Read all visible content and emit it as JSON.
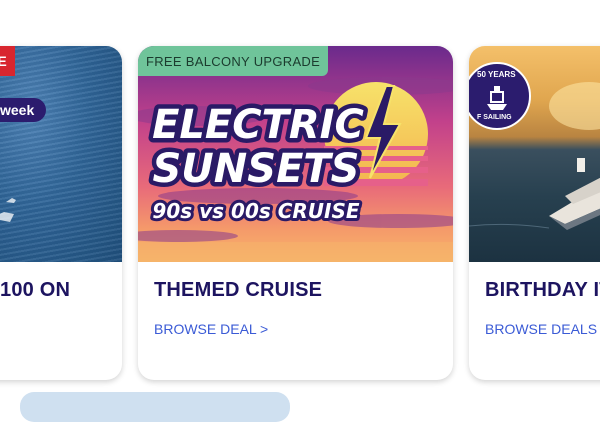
{
  "cards": [
    {
      "id": "left",
      "corner_badge": "SE",
      "pill": "week",
      "title": "100 ON",
      "link": ""
    },
    {
      "id": "center",
      "promo_badge": "FREE BALCONY UPGRADE",
      "art": {
        "line1": "ELECTRIC",
        "line2": "SUNSETS",
        "subtitle": "90s vs 00s CRUISE"
      },
      "title": "THEMED CRUISE",
      "link": "BROWSE DEAL >"
    },
    {
      "id": "right",
      "seal": {
        "top": "50 YEARS",
        "bottom": "F SAILING"
      },
      "title": "BIRTHDAY IT",
      "link": "BROWSE DEALS >"
    }
  ],
  "colors": {
    "title": "#1d1460",
    "link": "#3b5bd6",
    "promo_badge": "#6fc49a",
    "sale_badge": "#d8262f"
  }
}
